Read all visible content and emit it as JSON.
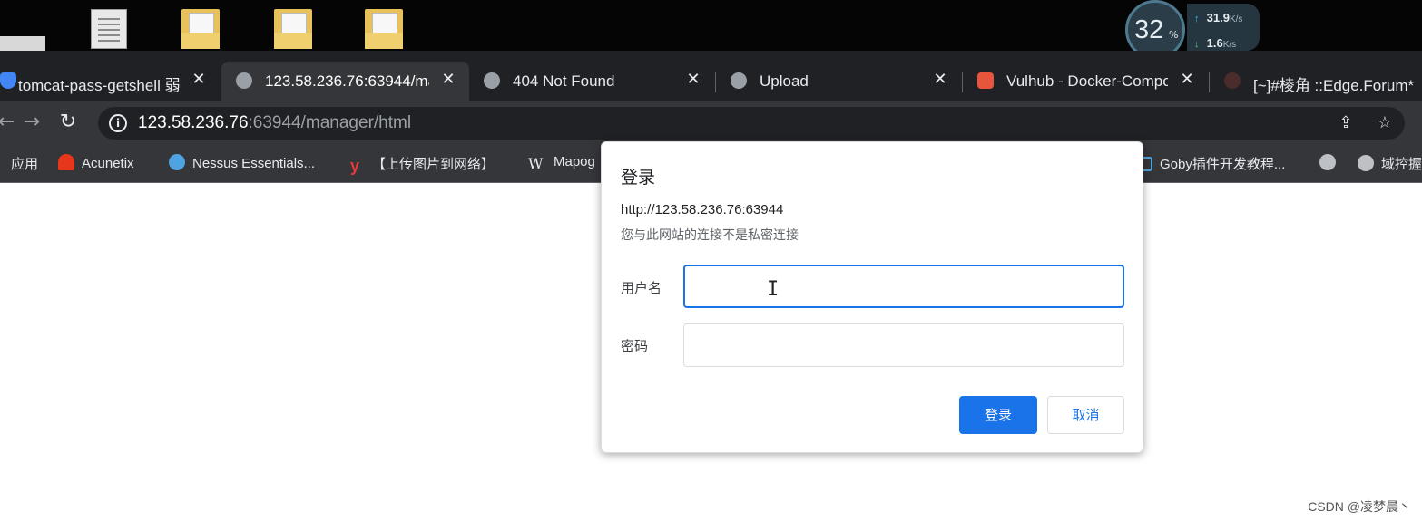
{
  "net_widget": {
    "cpu_percent": "32",
    "percent_sign": "%",
    "upload_speed": "31.9",
    "download_speed": "1.6",
    "unit": "K/s",
    "up_arrow": "↑",
    "down_arrow": "↓"
  },
  "tabs": [
    {
      "title": "tomcat-pass-getshell 弱",
      "icon": "shield-icon",
      "active": false
    },
    {
      "title": "123.58.236.76:63944/ma",
      "icon": "globe-icon",
      "active": true
    },
    {
      "title": "404 Not Found",
      "icon": "globe-icon",
      "active": false
    },
    {
      "title": "Upload",
      "icon": "globe-icon",
      "active": false
    },
    {
      "title": "Vulhub - Docker-Compo",
      "icon": "vulhub-icon",
      "active": false
    },
    {
      "title": "[~]#棱角 ::Edge.Forum*",
      "icon": "forum-icon",
      "active": false
    }
  ],
  "tab_close_glyph": "✕",
  "toolbar": {
    "back_glyph": "←",
    "forward_glyph": "→",
    "reload_glyph": "↻",
    "info_glyph": "i",
    "url_host": "123.58.236.76",
    "url_rest": ":63944/manager/html",
    "share_glyph": "⇪",
    "star_glyph": "☆"
  },
  "bookmarks": [
    {
      "label": "应用",
      "icon": "apps-icon"
    },
    {
      "label": "Acunetix",
      "icon": "acunetix-icon"
    },
    {
      "label": "Nessus Essentials...",
      "icon": "nessus-icon"
    },
    {
      "label": "【上传图片到网络】",
      "icon": "y-icon",
      "glyph": "y"
    },
    {
      "label": "Mapog",
      "icon": "wikipedia-icon",
      "glyph": "W"
    },
    {
      "label": "Goby插件开发教程...",
      "icon": "goby-icon"
    },
    {
      "label": "",
      "icon": "globe-icon"
    },
    {
      "label": "域控握",
      "icon": "globe-icon"
    }
  ],
  "dialog": {
    "title": "登录",
    "origin": "http://123.58.236.76:63944",
    "warning": "您与此网站的连接不是私密连接",
    "username_label": "用户名",
    "username_value": "",
    "password_label": "密码",
    "password_value": "",
    "cursor_glyph": "I",
    "login_button": "登录",
    "cancel_button": "取消"
  },
  "watermark": "CSDN @凌梦晨丶"
}
